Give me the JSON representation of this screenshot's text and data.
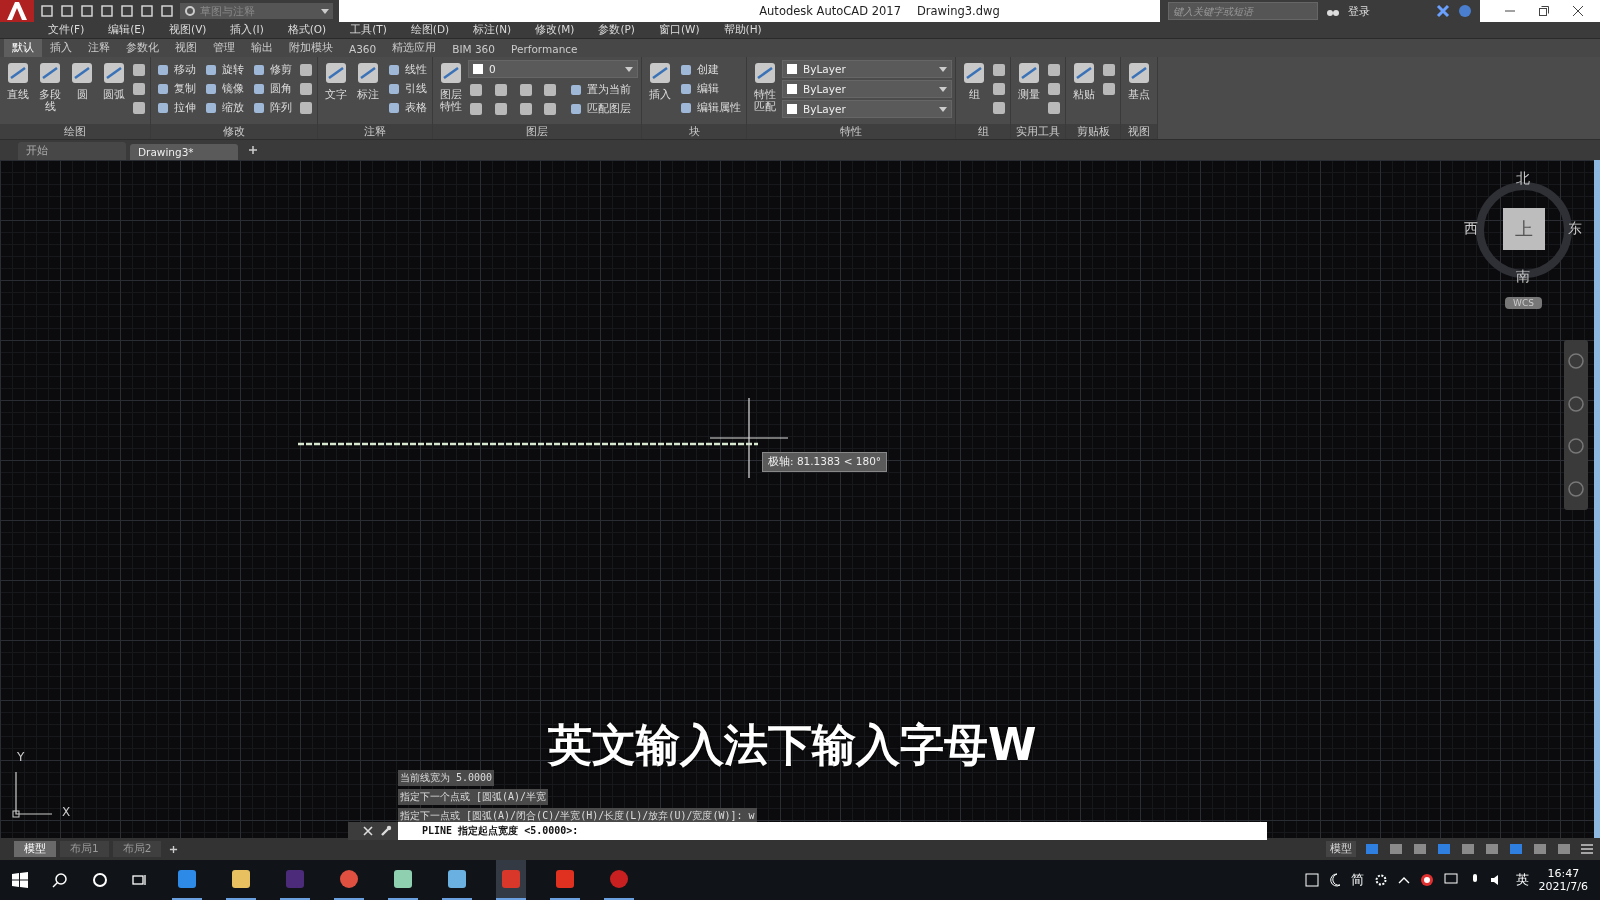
{
  "title_bar": {
    "workspace": "草图与注释",
    "title": "Autodesk AutoCAD 2017",
    "document": "Drawing3.dwg",
    "search": {
      "placeholder": "键入关键字或短语"
    },
    "sign_in": "登录"
  },
  "menu": [
    "文件(F)",
    "编辑(E)",
    "视图(V)",
    "插入(I)",
    "格式(O)",
    "工具(T)",
    "绘图(D)",
    "标注(N)",
    "修改(M)",
    "参数(P)",
    "窗口(W)",
    "帮助(H)"
  ],
  "ribbon_tabs": [
    {
      "label": "默认",
      "selected": true
    },
    {
      "label": "插入",
      "selected": false
    },
    {
      "label": "注释",
      "selected": false
    },
    {
      "label": "参数化",
      "selected": false
    },
    {
      "label": "视图",
      "selected": false
    },
    {
      "label": "管理",
      "selected": false
    },
    {
      "label": "输出",
      "selected": false
    },
    {
      "label": "附加模块",
      "selected": false
    },
    {
      "label": "A360",
      "selected": false
    },
    {
      "label": "精选应用",
      "selected": false
    },
    {
      "label": "BIM 360",
      "selected": false
    },
    {
      "label": "Performance",
      "selected": false
    }
  ],
  "panels": [
    {
      "title": "绘图",
      "big": [
        {
          "label": "直线"
        },
        {
          "label": "多段线"
        },
        {
          "label": "圆"
        },
        {
          "label": "圆弧"
        }
      ],
      "small": [
        {
          "kind": "icon"
        },
        {
          "kind": "icon"
        },
        {
          "kind": "icon"
        }
      ]
    },
    {
      "title": "修改",
      "small": [
        {
          "kind": "labeled",
          "label": "移动"
        },
        {
          "kind": "labeled",
          "label": "复制"
        },
        {
          "kind": "labeled",
          "label": "拉伸"
        },
        {
          "kind": "labeled",
          "label": "旋转"
        },
        {
          "kind": "labeled",
          "label": "镜像"
        },
        {
          "kind": "labeled",
          "label": "缩放"
        },
        {
          "kind": "labeled",
          "label": "修剪"
        },
        {
          "kind": "labeled",
          "label": "圆角"
        },
        {
          "kind": "labeled",
          "label": "阵列"
        },
        {
          "kind": "icon"
        },
        {
          "kind": "icon"
        },
        {
          "kind": "icon"
        }
      ]
    },
    {
      "title": "注释",
      "big": [
        {
          "label": "文字"
        },
        {
          "label": "标注"
        }
      ],
      "small": [
        {
          "kind": "labeled",
          "label": "线性"
        },
        {
          "kind": "labeled",
          "label": "引线"
        },
        {
          "kind": "labeled",
          "label": "表格"
        }
      ]
    },
    {
      "title": "图层",
      "big": [
        {
          "label": "图层特性"
        }
      ],
      "dropdowns": [
        "0"
      ],
      "small": [
        {
          "kind": "icon"
        },
        {
          "kind": "icon"
        },
        {
          "kind": "icon"
        },
        {
          "kind": "icon"
        },
        {
          "kind": "icon"
        },
        {
          "kind": "icon"
        },
        {
          "kind": "icon"
        },
        {
          "kind": "icon"
        },
        {
          "kind": "labeled",
          "label": "置为当前"
        },
        {
          "kind": "labeled",
          "label": "匹配图层"
        }
      ]
    },
    {
      "title": "块",
      "big": [
        {
          "label": "插入"
        }
      ],
      "small": [
        {
          "kind": "labeled",
          "label": "创建"
        },
        {
          "kind": "labeled",
          "label": "编辑"
        },
        {
          "kind": "labeled",
          "label": "编辑属性"
        }
      ]
    },
    {
      "title": "特性",
      "big": [
        {
          "label": "特性匹配"
        }
      ],
      "dropdowns": [
        "ByLayer",
        "ByLayer",
        "ByLayer"
      ]
    },
    {
      "title": "组",
      "big": [
        {
          "label": "组"
        }
      ],
      "small": [
        {
          "kind": "icon"
        },
        {
          "kind": "icon"
        },
        {
          "kind": "icon"
        }
      ]
    },
    {
      "title": "实用工具",
      "big": [
        {
          "label": "测量"
        }
      ],
      "small": [
        {
          "kind": "icon"
        },
        {
          "kind": "icon"
        },
        {
          "kind": "icon"
        }
      ]
    },
    {
      "title": "剪贴板",
      "big": [
        {
          "label": "粘贴"
        }
      ],
      "small": [
        {
          "kind": "icon"
        },
        {
          "kind": "icon"
        }
      ]
    },
    {
      "title": "视图",
      "big": [
        {
          "label": "基点"
        }
      ]
    }
  ],
  "file_tabs": [
    {
      "label": "开始",
      "selected": false
    },
    {
      "label": "Drawing3*",
      "selected": true
    }
  ],
  "viewcube": {
    "north": "北",
    "south": "南",
    "west": "西",
    "east": "东",
    "face": "上",
    "ucs": "WCS"
  },
  "tooltip": "极轴: 81.1383 < 180°",
  "axes": {
    "x": "X",
    "y": "Y"
  },
  "caption": "英文输入法下输入字母W",
  "command_history": [
    "当前线宽为 5.0000",
    "指定下一个点或 [圆弧(A)/半宽",
    "指定下一点或 [圆弧(A)/闭合(C)/半宽(H)/长度(L)/放弃(U)/宽度(W)]: w"
  ],
  "command_line": "PLINE 指定起点宽度 <5.0000>:",
  "layout_tabs": [
    {
      "label": "模型",
      "selected": true
    },
    {
      "label": "布局1",
      "selected": false
    },
    {
      "label": "布局2",
      "selected": false
    }
  ],
  "status_bar": {
    "space": "模型"
  },
  "taskbar": {
    "ime_mode": "简",
    "language": "英",
    "time": "16:47",
    "date": "2021/7/6"
  }
}
